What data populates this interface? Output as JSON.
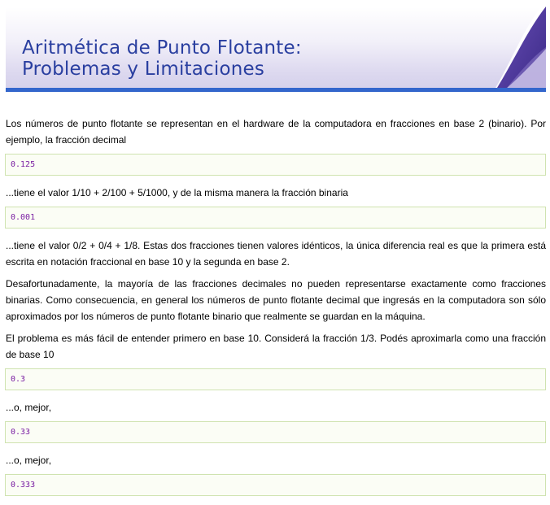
{
  "header": {
    "title_line1": "Aritmética de Punto Flotante:",
    "title_line2": "Problemas y Limitaciones"
  },
  "content": {
    "p1": "Los números de punto flotante se representan en el hardware de la computadora en fracciones en base 2 (binario). Por ejemplo, la fracción decimal",
    "code1": "0.125",
    "p2": "...tiene el valor 1/10 + 2/100 + 5/1000, y de la misma manera la fracción binaria",
    "code2": "0.001",
    "p3": "...tiene el valor 0/2 + 0/4 + 1/8. Estas dos fracciones tienen valores idénticos, la única diferencia real es que la primera está escrita en notación fraccional en base 10 y la segunda en base 2.",
    "p4": "Desafortunadamente, la mayoría de las fracciones decimales no pueden representarse exactamente como fracciones binarias. Como consecuencia, en general los números de punto flotante decimal que ingresás en la computadora son sólo aproximados por los números de punto flotante binario que realmente se guardan en la máquina.",
    "p5": "El problema es más fácil de entender primero en base 10. Considerá la fracción 1/3. Podés aproximarla como una fracción de base 10",
    "code3": "0.3",
    "p6": "...o, mejor,",
    "code4": "0.33",
    "p7": "...o, mejor,",
    "code5": "0.333"
  },
  "colors": {
    "title": "#2a3fa0",
    "header_bar": "#3366cc",
    "code_text": "#7a1fa2",
    "code_border": "#cfe3b0"
  }
}
